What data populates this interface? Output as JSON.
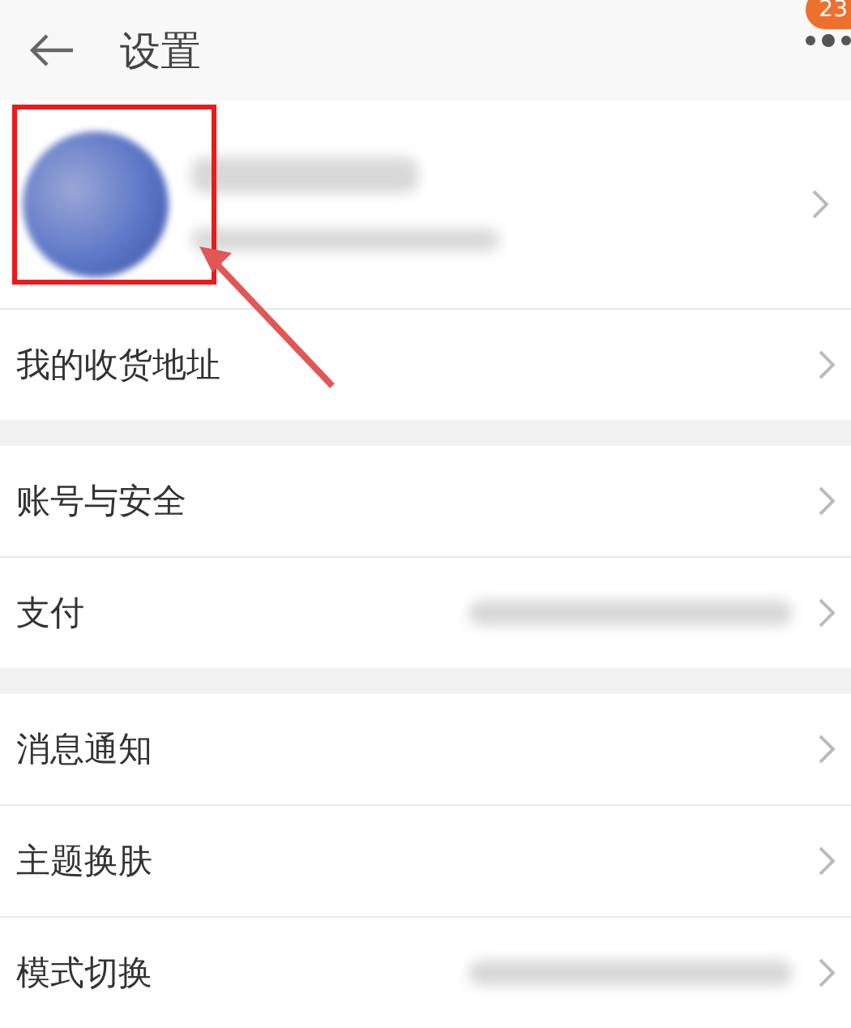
{
  "header": {
    "title": "设置",
    "badge": "23"
  },
  "profile": {
    "name_redacted": true,
    "highlighted": true
  },
  "groups": [
    {
      "rows": [
        {
          "label": "我的收货地址",
          "value_redacted": false
        }
      ]
    },
    {
      "rows": [
        {
          "label": "账号与安全",
          "value_redacted": false
        },
        {
          "label": "支付",
          "value_redacted": true
        }
      ]
    },
    {
      "rows": [
        {
          "label": "消息通知",
          "value_redacted": false
        },
        {
          "label": "主题换肤",
          "value_redacted": false
        },
        {
          "label": "模式切换",
          "value_redacted": true
        }
      ]
    }
  ]
}
